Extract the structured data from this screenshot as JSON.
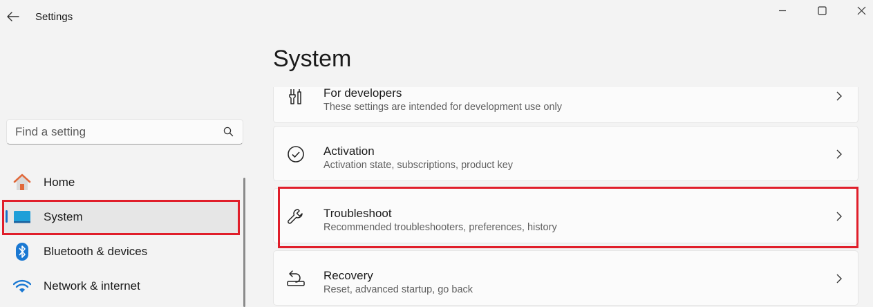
{
  "window": {
    "title": "Settings",
    "controls": [
      "minimize-icon",
      "maximize-icon",
      "close-icon"
    ]
  },
  "search": {
    "placeholder": "Find a setting",
    "value": ""
  },
  "sidebar": {
    "items": [
      {
        "label": "Home",
        "icon": "home-icon"
      },
      {
        "label": "System",
        "icon": "system-display-icon",
        "selected": true
      },
      {
        "label": "Bluetooth & devices",
        "icon": "bluetooth-icon"
      },
      {
        "label": "Network & internet",
        "icon": "wifi-icon"
      }
    ]
  },
  "main": {
    "title": "System",
    "cards": [
      {
        "title": "For developers",
        "subtitle": "These settings are intended for development use only",
        "icon": "developer-tools-icon"
      },
      {
        "title": "Activation",
        "subtitle": "Activation state, subscriptions, product key",
        "icon": "activation-check-icon"
      },
      {
        "title": "Troubleshoot",
        "subtitle": "Recommended troubleshooters, preferences, history",
        "icon": "wrench-icon"
      },
      {
        "title": "Recovery",
        "subtitle": "Reset, advanced startup, go back",
        "icon": "recovery-icon"
      }
    ]
  },
  "colors": {
    "accent": "#1a73c8",
    "highlight": "#e01e2a",
    "background": "#f3f3f3",
    "card": "#fbfbfb"
  }
}
